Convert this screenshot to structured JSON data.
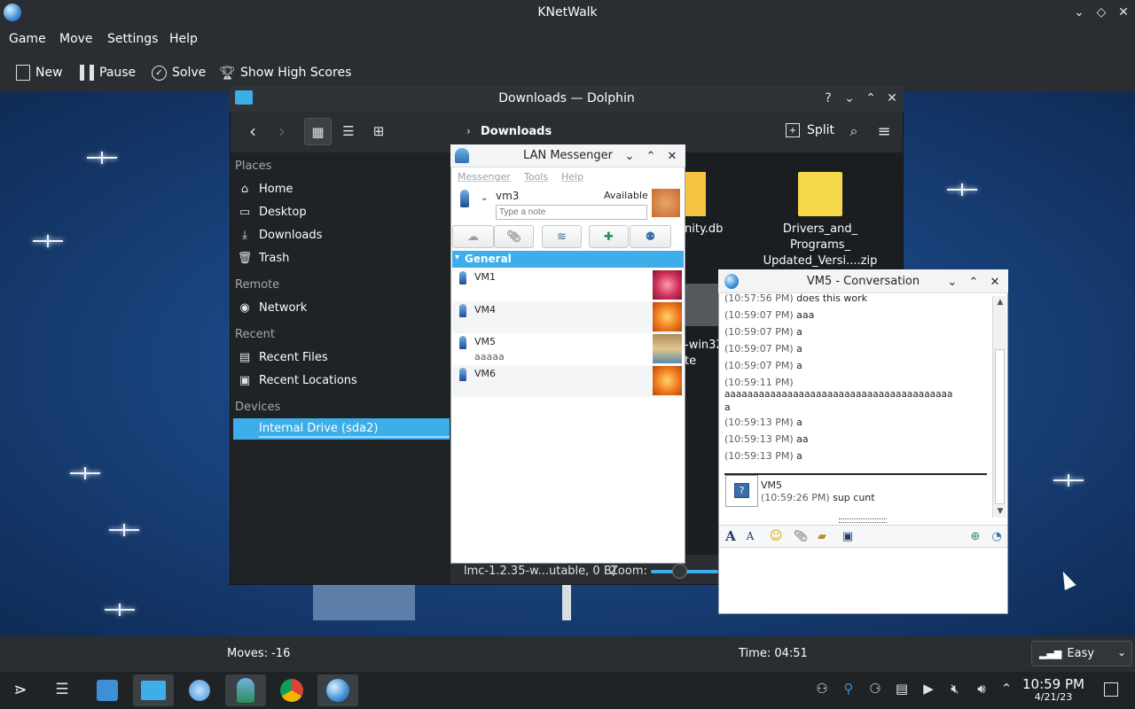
{
  "knetwalk": {
    "title": "KNetWalk",
    "menu": [
      "Game",
      "Move",
      "Settings",
      "Help"
    ],
    "toolbar": {
      "new_label": "New",
      "pause_label": "Pause",
      "solve_label": "Solve",
      "highscores_label": "Show High Scores"
    },
    "status": {
      "moves": "Moves: -16",
      "time": "Time: 04:51",
      "difficulty": "Easy"
    }
  },
  "dolphin": {
    "title": "Downloads — Dolphin",
    "breadcrumb": "Downloads",
    "split_label": "Split",
    "places": {
      "places_header": "Places",
      "home": "Home",
      "desktop": "Desktop",
      "downloads": "Downloads",
      "trash": "Trash",
      "remote_header": "Remote",
      "network": "Network",
      "recent_header": "Recent",
      "recent_files": "Recent Files",
      "recent_locations": "Recent Locations",
      "devices_header": "Devices",
      "internal_drive": "Internal Drive (sda2)"
    },
    "files": {
      "file1_partial": "nity.db",
      "file2_line1": "Drivers_and_",
      "file2_line2": "Programs_",
      "file2_line3": "Updated_Versi....zip",
      "file3_partial_a": "-win32",
      "file3_partial_b": "te"
    },
    "status_text": "lmc-1.2.35-w...utable, 0 B)",
    "zoom_label": "Zoom:"
  },
  "lan_messenger": {
    "title": "LAN Messenger",
    "menu": [
      "Messenger",
      "Tools",
      "Help"
    ],
    "user_name": "vm3",
    "status": "Available",
    "note_placeholder": "Type a note",
    "group_name": "General",
    "buddies": [
      {
        "name": "VM1",
        "note": ""
      },
      {
        "name": "VM4",
        "note": ""
      },
      {
        "name": "VM5",
        "note": "aaaaa"
      },
      {
        "name": "VM6",
        "note": ""
      }
    ]
  },
  "conversation": {
    "title": "VM5 - Conversation",
    "messages": [
      {
        "ts": "(10:57:56 PM)",
        "text": "does this work"
      },
      {
        "ts": "(10:59:07 PM)",
        "text": "aaa"
      },
      {
        "ts": "(10:59:07 PM)",
        "text": "a"
      },
      {
        "ts": "(10:59:07 PM)",
        "text": "a"
      },
      {
        "ts": "(10:59:07 PM)",
        "text": "a"
      },
      {
        "ts": "(10:59:11 PM)",
        "text": ""
      },
      {
        "ts": "",
        "text": "aaaaaaaaaaaaaaaaaaaaaaaaaaaaaaaaaaaaaaaa"
      },
      {
        "ts": "",
        "text": "a"
      },
      {
        "ts": "(10:59:13 PM)",
        "text": "a"
      },
      {
        "ts": "(10:59:13 PM)",
        "text": "aa"
      },
      {
        "ts": "(10:59:13 PM)",
        "text": "a"
      }
    ],
    "last_sender": "VM5",
    "last_ts": "(10:59:26 PM)",
    "last_text": "sup cunt"
  },
  "taskbar": {
    "clock_time": "10:59 PM",
    "clock_date": "4/21/23"
  },
  "colors": {
    "accent": "#3daee9",
    "panel": "#2a2e32",
    "game_bg": "#1a447f"
  }
}
